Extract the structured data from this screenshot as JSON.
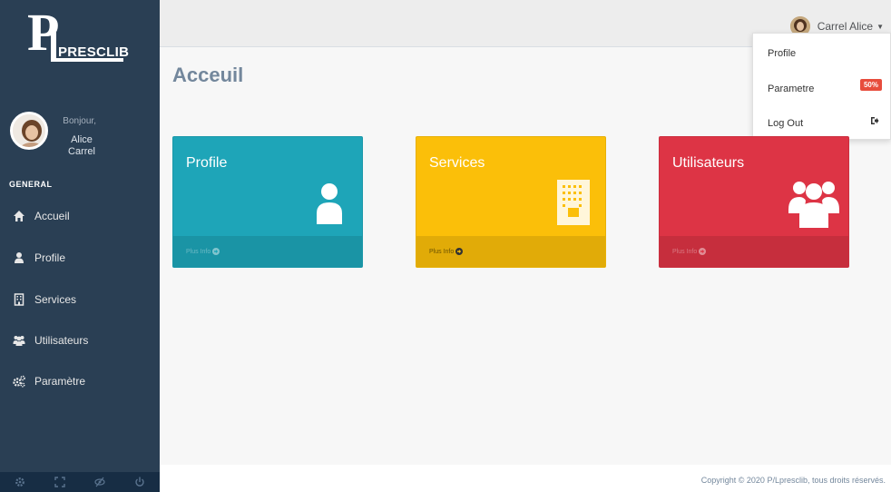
{
  "brand": {
    "logo_letter": "P",
    "logo_text": "PRESCLIB"
  },
  "sidebar": {
    "greeting": "Bonjour,",
    "user_first": "Alice",
    "user_last": "Carrel",
    "section_title": "GENERAL",
    "items": [
      {
        "label": "Accueil",
        "icon": "home-icon"
      },
      {
        "label": "Profile",
        "icon": "user-icon"
      },
      {
        "label": "Services",
        "icon": "building-icon"
      },
      {
        "label": "Utilisateurs",
        "icon": "users-icon"
      },
      {
        "label": "Paramètre",
        "icon": "cogs-icon"
      }
    ],
    "footer_icons": [
      "settings-icon",
      "fullscreen-icon",
      "hide-icon",
      "power-icon"
    ]
  },
  "topnav": {
    "user_name": "Carrel Alice"
  },
  "dropdown": {
    "items": [
      {
        "label": "Profile"
      },
      {
        "label": "Parametre",
        "badge": "50%"
      },
      {
        "label": "Log Out",
        "icon": "sign-out-icon"
      }
    ]
  },
  "page": {
    "title": "Acceuil"
  },
  "cards": [
    {
      "title": "Profile",
      "more": "Plus Info",
      "color": "#1ea5b8",
      "icon": "user-icon"
    },
    {
      "title": "Services",
      "more": "Plus Info",
      "color": "#fbbf09",
      "icon": "building-icon"
    },
    {
      "title": "Utilisateurs",
      "more": "Plus Info",
      "color": "#dd3445",
      "icon": "users-icon"
    }
  ],
  "footer": {
    "copyright": "Copyright © 2020 P/Lpresclib, tous droits réservés."
  }
}
